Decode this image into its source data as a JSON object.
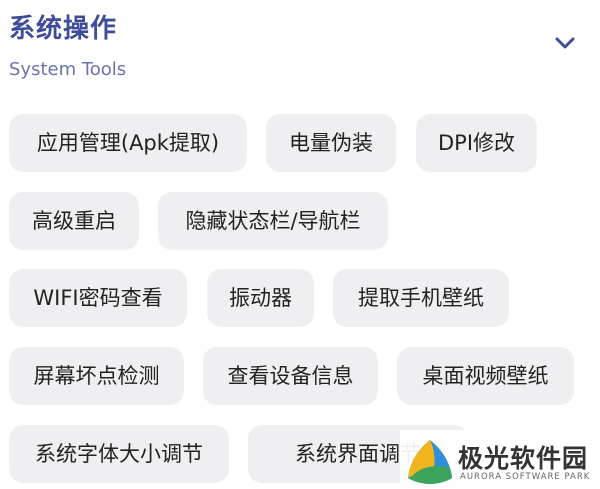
{
  "header": {
    "title": "系统操作",
    "subtitle": "System Tools",
    "collapse_icon": "chevron-down-icon"
  },
  "tools": [
    {
      "label": "应用管理(Apk提取)"
    },
    {
      "label": "电量伪装"
    },
    {
      "label": "DPI修改"
    },
    {
      "label": "高级重启"
    },
    {
      "label": "隐藏状态栏/导航栏"
    },
    {
      "label": "WIFI密码查看"
    },
    {
      "label": "振动器"
    },
    {
      "label": "提取手机壁纸"
    },
    {
      "label": "屏幕坏点检测"
    },
    {
      "label": "查看设备信息"
    },
    {
      "label": "桌面视频壁纸"
    },
    {
      "label": "系统字体大小调节"
    },
    {
      "label": "系统界面调节"
    }
  ],
  "watermark": {
    "name": "极光软件园",
    "subtitle": "AURORA SOFTWARE PARK",
    "icon": "aurora-logo-icon"
  },
  "colors": {
    "accent": "#3f4c9a",
    "chip_background": "#efeff1"
  }
}
